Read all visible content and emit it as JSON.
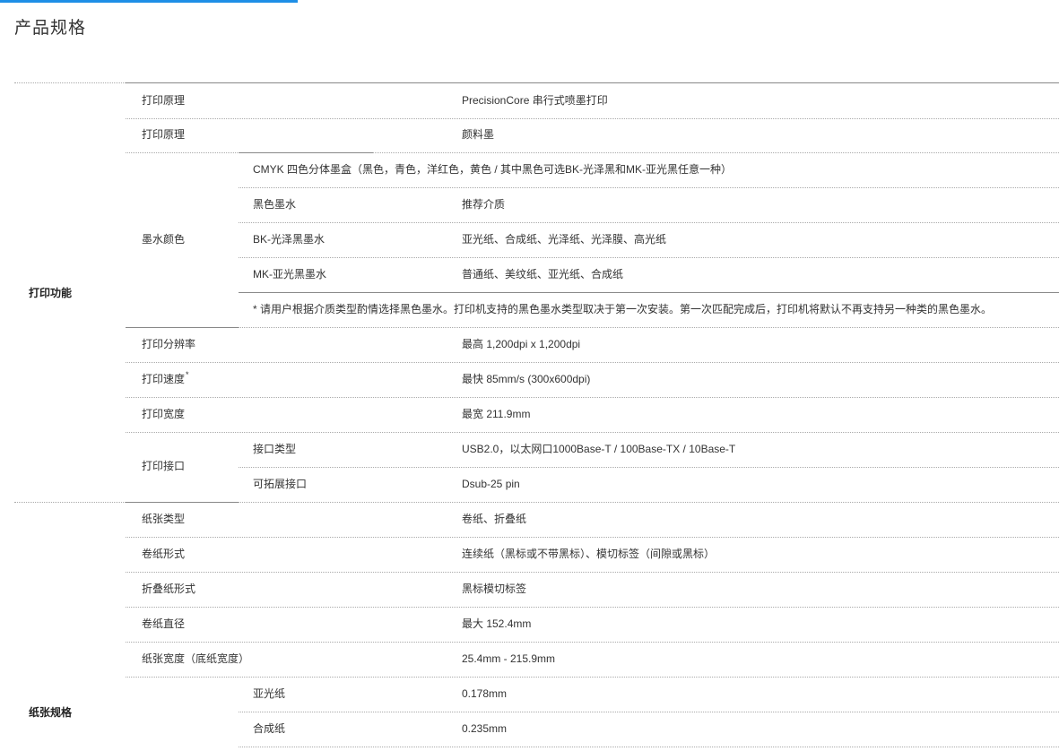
{
  "page": {
    "title": "产品规格"
  },
  "groups": {
    "print": {
      "label": "打印功能"
    },
    "paper": {
      "label": "纸张规格"
    }
  },
  "rows": {
    "principle1": {
      "label": "打印原理",
      "value": "PrecisionCore 串行式喷墨打印"
    },
    "principle2": {
      "label": "打印原理",
      "value": "颜料墨"
    },
    "ink": {
      "label": "墨水颜色",
      "cartridge": "CMYK 四色分体墨盒（黑色，青色，洋红色，黄色 / 其中黑色可选BK-光泽黑和MK-亚光黑任意一种）",
      "header_sub": "黑色墨水",
      "header_val": "推荐介质",
      "bk_sub": "BK-光泽黑墨水",
      "bk_val": "亚光纸、合成纸、光泽纸、光泽膜、高光纸",
      "mk_sub": "MK-亚光黑墨水",
      "mk_val": "普通纸、美纹纸、亚光纸、合成纸",
      "note": "* 请用户根据介质类型酌情选择黑色墨水。打印机支持的黑色墨水类型取决于第一次安装。第一次匹配完成后，打印机将默认不再支持另一种类的黑色墨水。"
    },
    "resolution": {
      "label": "打印分辨率",
      "value": "最高 1,200dpi x 1,200dpi"
    },
    "speed": {
      "label": "打印速度",
      "sup": "*",
      "value": "最快 85mm/s (300x600dpi)"
    },
    "width": {
      "label": "打印宽度",
      "value": "最宽 211.9mm"
    },
    "interface": {
      "label": "打印接口",
      "type_sub": "接口类型",
      "type_val": "USB2.0，以太网口1000Base-T / 100Base-TX / 10Base-T",
      "ext_sub": "可拓展接口",
      "ext_val": "Dsub-25 pin"
    },
    "paper_type": {
      "label": "纸张类型",
      "value": "卷纸、折叠纸"
    },
    "roll_form": {
      "label": "卷纸形式",
      "value": "连续纸（黑标或不带黑标）、模切标签（间隙或黑标）"
    },
    "fan_form": {
      "label": "折叠纸形式",
      "value": "黑标模切标签"
    },
    "roll_diam": {
      "label": "卷纸直径",
      "value": "最大 152.4mm"
    },
    "paper_width": {
      "label": "纸张宽度（底纸宽度）",
      "value": "25.4mm - 215.9mm"
    },
    "thickness": {
      "matte_sub": "亚光纸",
      "matte_val": "0.178mm",
      "synth_sub": "合成纸",
      "synth_val": "0.235mm"
    }
  }
}
